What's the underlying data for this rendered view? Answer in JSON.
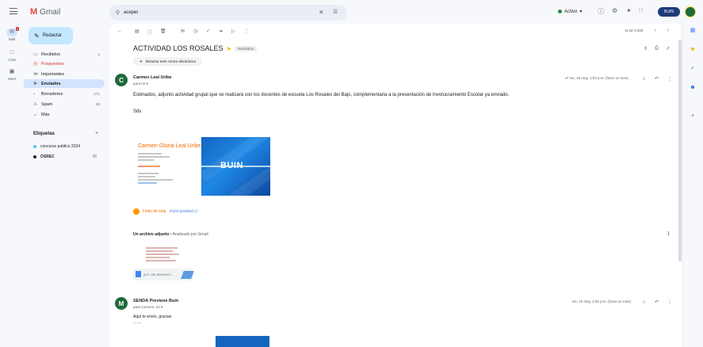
{
  "app": {
    "name": "Gmail"
  },
  "search": {
    "query": "acepet"
  },
  "status": {
    "label": "Activo"
  },
  "account": {
    "label": "BUIN"
  },
  "rail": [
    {
      "label": "Mail",
      "badge": "9"
    },
    {
      "label": "Chat"
    },
    {
      "label": "Meet"
    }
  ],
  "sidebar": {
    "compose": "Redactar",
    "items": [
      {
        "label": "Recibidos",
        "count": "1"
      },
      {
        "label": "Pospuestos",
        "count": ""
      },
      {
        "label": "Importantes",
        "count": ""
      },
      {
        "label": "Enviados",
        "count": ""
      },
      {
        "label": "Borradores",
        "count": "171"
      },
      {
        "label": "Spam",
        "count": "23"
      },
      {
        "label": "Más",
        "count": ""
      }
    ],
    "labels_title": "Etiquetas",
    "labels": [
      {
        "label": "concurso publico 2024",
        "color": "#4fc3f7"
      },
      {
        "label": "OSREC",
        "color": "#202124",
        "count": "16"
      }
    ]
  },
  "toolbar": {
    "pager": "11 de 5.000"
  },
  "thread": {
    "subject": "ACTIVIDAD LOS ROSALES",
    "chip": "Recibidos",
    "summary": "Resume este correo electrónico"
  },
  "message1": {
    "avatar": "C",
    "sender": "Carmen Leal Uribe",
    "email": "",
    "to": "para mí",
    "date": "vie, 10 may, 1:53 p.m. (hace un mes)",
    "body": "Estimados, adjunto actividad grupal que se realizará con los docentes de escuela Los Rosales del Bajo, complementaria a la presentación de Involucramiento Escolar ya enviado.",
    "greeting": "Sds",
    "signature": {
      "name": "Carmen Gloria Leal Uribe"
    },
    "logo_text": "BUIN",
    "link_label": "Links de esta",
    "link_url": "municipalidad.cl",
    "attachments_header": "Un archivo adjunto",
    "attachments_scan": "Analizado por Gmail",
    "attachment_name": "ACT. DE ARCHIVO..."
  },
  "message2": {
    "avatar": "M",
    "sender": "SENDA Previene Buin",
    "email": "",
    "to": "para Carmen, mí",
    "date": "vie, 10 may, 2:02 p.m. (hace un mes)",
    "body": "Aquí te envío, gracias",
    "dashes": "— —"
  },
  "colors": {
    "accent": "#c2e7ff",
    "active_nav": "#d3e3fd",
    "brand_red": "#ea4335",
    "avatar_green": "#1e6b3a"
  }
}
